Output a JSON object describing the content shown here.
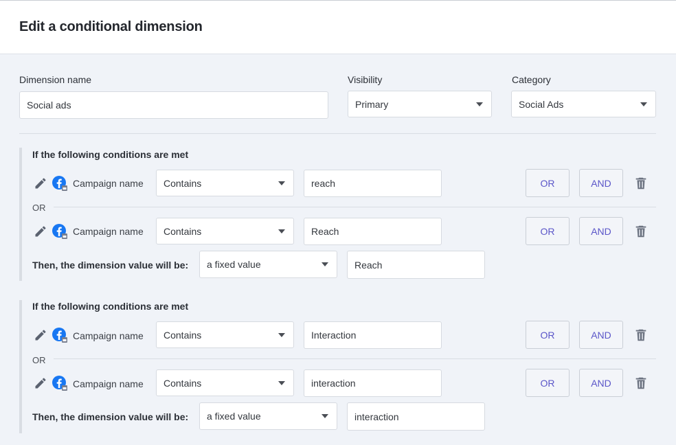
{
  "header": {
    "title": "Edit a conditional dimension"
  },
  "form": {
    "name_label": "Dimension name",
    "name_value": "Social ads",
    "visibility_label": "Visibility",
    "visibility_value": "Primary",
    "category_label": "Category",
    "category_value": "Social Ads"
  },
  "groups": [
    {
      "title": "If the following conditions are met",
      "conditions": [
        {
          "field": "Campaign name",
          "operator": "Contains",
          "value": "reach"
        },
        {
          "field": "Campaign name",
          "operator": "Contains",
          "value": "Reach"
        }
      ],
      "or_label": "OR",
      "then_label": "Then, the dimension value will be:",
      "then_type": "a fixed value",
      "then_value": "Reach"
    },
    {
      "title": "If the following conditions are met",
      "conditions": [
        {
          "field": "Campaign name",
          "operator": "Contains",
          "value": "Interaction"
        },
        {
          "field": "Campaign name",
          "operator": "Contains",
          "value": "interaction"
        }
      ],
      "or_label": "OR",
      "then_label": "Then, the dimension value will be:",
      "then_type": "a fixed value",
      "then_value": "interaction"
    }
  ],
  "buttons": {
    "or": "OR",
    "and": "AND"
  },
  "icons": {
    "edit": "pencil-icon",
    "source": "facebook-icon",
    "delete": "trash-icon"
  },
  "colors": {
    "accent": "#5a55c8",
    "facebook": "#1877f2",
    "background": "#f0f3f8"
  }
}
